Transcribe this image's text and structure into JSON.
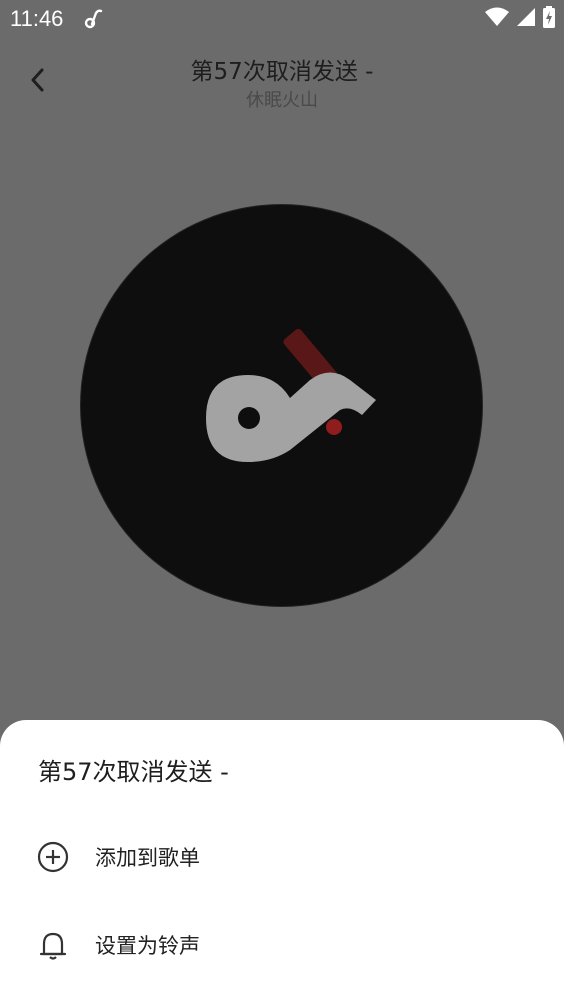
{
  "status_bar": {
    "time": "11:46",
    "app_icon": "music-note-icon",
    "icons": [
      "wifi-icon",
      "signal-icon",
      "battery-charging-icon"
    ]
  },
  "header": {
    "title": "第57次取消发送 -",
    "artist": "休眠火山",
    "back_icon": "chevron-left-icon"
  },
  "player": {
    "disc_logo": "app-logo-icon"
  },
  "sheet": {
    "title": "第57次取消发送 -",
    "items": [
      {
        "label": "添加到歌单",
        "icon": "add-circle-icon"
      },
      {
        "label": "设置为铃声",
        "icon": "bell-icon"
      }
    ]
  },
  "colors": {
    "overlay": "#6b6b6b",
    "disc": "#0e0e0e",
    "logo": "#a3a3a3",
    "accent": "#8f1d1d",
    "sheet": "#ffffff"
  }
}
